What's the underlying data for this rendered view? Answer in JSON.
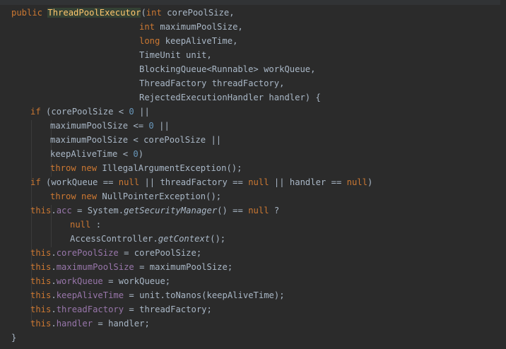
{
  "editor": {
    "top_fragment": "}",
    "lines": [
      {
        "tokens": [
          [
            "public ",
            "kw"
          ],
          [
            "ThreadPoolExecutor",
            "hl"
          ],
          [
            "(",
            ""
          ],
          [
            "int ",
            "kw"
          ],
          [
            "corePoolSize,",
            ""
          ]
        ]
      },
      {
        "tokens": [
          [
            "int ",
            "kw"
          ],
          [
            "maximumPoolSize,",
            ""
          ]
        ]
      },
      {
        "tokens": [
          [
            "long ",
            "kw"
          ],
          [
            "keepAliveTime,",
            ""
          ]
        ]
      },
      {
        "tokens": [
          [
            "TimeUnit unit,",
            ""
          ]
        ]
      },
      {
        "tokens": [
          [
            "BlockingQueue<Runnable> workQueue,",
            ""
          ]
        ]
      },
      {
        "tokens": [
          [
            "ThreadFactory threadFactory,",
            ""
          ]
        ]
      },
      {
        "tokens": [
          [
            "RejectedExecutionHandler handler) {",
            ""
          ]
        ]
      },
      {
        "tokens": [
          [
            "if ",
            "kw"
          ],
          [
            "(corePoolSize < ",
            ""
          ],
          [
            "0",
            "num"
          ],
          [
            " ||",
            ""
          ]
        ]
      },
      {
        "tokens": [
          [
            "maximumPoolSize <= ",
            ""
          ],
          [
            "0",
            "num"
          ],
          [
            " ||",
            ""
          ]
        ]
      },
      {
        "tokens": [
          [
            "maximumPoolSize < corePoolSize ||",
            ""
          ]
        ]
      },
      {
        "tokens": [
          [
            "keepAliveTime < ",
            ""
          ],
          [
            "0",
            "num"
          ],
          [
            ")",
            ""
          ]
        ]
      },
      {
        "tokens": [
          [
            "throw new ",
            "kw"
          ],
          [
            "IllegalArgumentException();",
            ""
          ]
        ]
      },
      {
        "tokens": [
          [
            "if ",
            "kw"
          ],
          [
            "(workQueue == ",
            ""
          ],
          [
            "null",
            "kw"
          ],
          [
            " || threadFactory == ",
            ""
          ],
          [
            "null",
            "kw"
          ],
          [
            " || handler == ",
            ""
          ],
          [
            "null",
            "kw"
          ],
          [
            ")",
            ""
          ]
        ]
      },
      {
        "tokens": [
          [
            "throw new ",
            "kw"
          ],
          [
            "NullPointerException();",
            ""
          ]
        ]
      },
      {
        "tokens": [
          [
            "this",
            "kw"
          ],
          [
            ".",
            ""
          ],
          [
            "acc",
            "fld"
          ],
          [
            " = System.",
            ""
          ],
          [
            "getSecurityManager",
            "it"
          ],
          [
            "() == ",
            ""
          ],
          [
            "null",
            "kw"
          ],
          [
            " ?",
            ""
          ]
        ]
      },
      {
        "tokens": [
          [
            "null",
            "kw"
          ],
          [
            " :",
            ""
          ]
        ]
      },
      {
        "tokens": [
          [
            "AccessController.",
            ""
          ],
          [
            "getContext",
            "it"
          ],
          [
            "();",
            ""
          ]
        ]
      },
      {
        "tokens": [
          [
            "this",
            "kw"
          ],
          [
            ".",
            ""
          ],
          [
            "corePoolSize",
            "fld"
          ],
          [
            " = corePoolSize;",
            ""
          ]
        ]
      },
      {
        "tokens": [
          [
            "this",
            "kw"
          ],
          [
            ".",
            ""
          ],
          [
            "maximumPoolSize",
            "fld"
          ],
          [
            " = maximumPoolSize;",
            ""
          ]
        ]
      },
      {
        "tokens": [
          [
            "this",
            "kw"
          ],
          [
            ".",
            ""
          ],
          [
            "workQueue",
            "fld"
          ],
          [
            " = workQueue;",
            ""
          ]
        ]
      },
      {
        "tokens": [
          [
            "this",
            "kw"
          ],
          [
            ".",
            ""
          ],
          [
            "keepAliveTime",
            "fld"
          ],
          [
            " = unit.toNanos(keepAliveTime);",
            ""
          ]
        ]
      },
      {
        "tokens": [
          [
            "this",
            "kw"
          ],
          [
            ".",
            ""
          ],
          [
            "threadFactory",
            "fld"
          ],
          [
            " = threadFactory;",
            ""
          ]
        ]
      },
      {
        "tokens": [
          [
            "this",
            "kw"
          ],
          [
            ".",
            ""
          ],
          [
            "handler",
            "fld"
          ],
          [
            " = handler;",
            ""
          ]
        ]
      },
      {
        "tokens": [
          [
            "}",
            ""
          ]
        ]
      }
    ]
  }
}
